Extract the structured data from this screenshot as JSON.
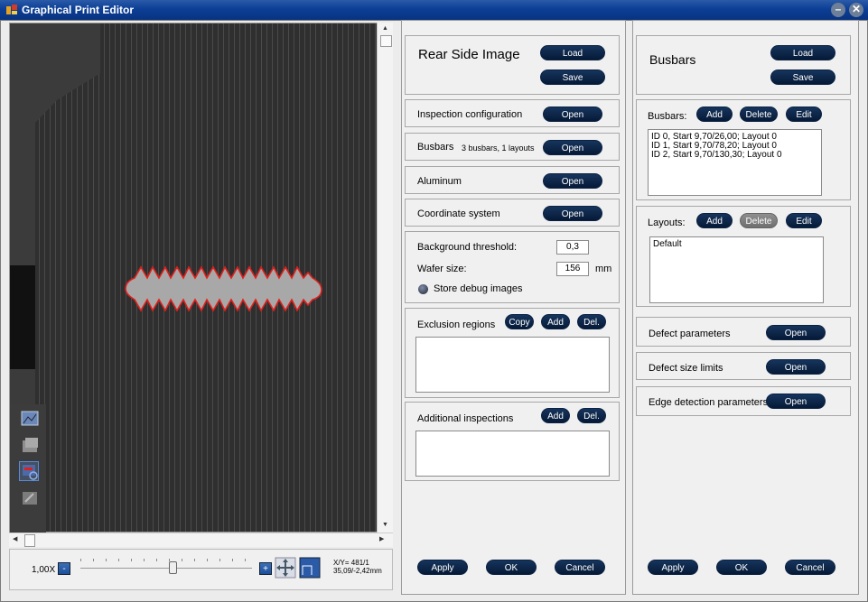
{
  "window": {
    "title": "Graphical Print Editor",
    "minimize_icon": "minimize-icon",
    "close_icon": "close-icon"
  },
  "viewer": {
    "zoom_label": "1,00X",
    "zoom_minus": "-",
    "zoom_plus": "+",
    "coord_line1": "X/Y= 481/1",
    "coord_line2": "35,09/-2,42mm",
    "tools": [
      "image-view-icon",
      "layer-icon",
      "busbar-tool-icon",
      "edit-image-icon"
    ]
  },
  "middle": {
    "title": "Rear Side Image",
    "load": "Load",
    "save": "Save",
    "inspection_config": {
      "label": "Inspection configuration",
      "button": "Open"
    },
    "busbars": {
      "label": "Busbars",
      "info": "3 busbars, 1 layouts",
      "button": "Open"
    },
    "aluminum": {
      "label": "Aluminum",
      "button": "Open"
    },
    "coordinate": {
      "label": "Coordinate system",
      "button": "Open"
    },
    "background_threshold": {
      "label": "Background threshold:",
      "value": "0,3"
    },
    "wafer_size": {
      "label": "Wafer size:",
      "value": "156",
      "unit": "mm"
    },
    "store_debug": "Store debug images",
    "exclusion": {
      "label": "Exclusion regions",
      "copy": "Copy",
      "add": "Add",
      "del": "Del."
    },
    "additional": {
      "label": "Additional inspections",
      "add": "Add",
      "del": "Del."
    },
    "apply": "Apply",
    "ok": "OK",
    "cancel": "Cancel"
  },
  "right": {
    "title": "Busbars",
    "load": "Load",
    "save": "Save",
    "busbars": {
      "label": "Busbars:",
      "add": "Add",
      "delete": "Delete",
      "edit": "Edit",
      "items": [
        "ID 0, Start 9,70/26,00; Layout 0",
        "ID 1, Start 9,70/78,20; Layout 0",
        "ID 2, Start 9,70/130,30; Layout 0"
      ]
    },
    "layouts": {
      "label": "Layouts:",
      "add": "Add",
      "delete": "Delete",
      "edit": "Edit",
      "items": [
        "Default"
      ]
    },
    "defect_params": {
      "label": "Defect parameters",
      "button": "Open"
    },
    "defect_size": {
      "label": "Defect size limits",
      "button": "Open"
    },
    "edge_detection": {
      "label": "Edge detection parameters",
      "button": "Open"
    },
    "apply": "Apply",
    "ok": "OK",
    "cancel": "Cancel"
  },
  "colors": {
    "button": "#0a2142",
    "title_bar": "#0c3f96",
    "busbar_outline": "#e0201c"
  }
}
